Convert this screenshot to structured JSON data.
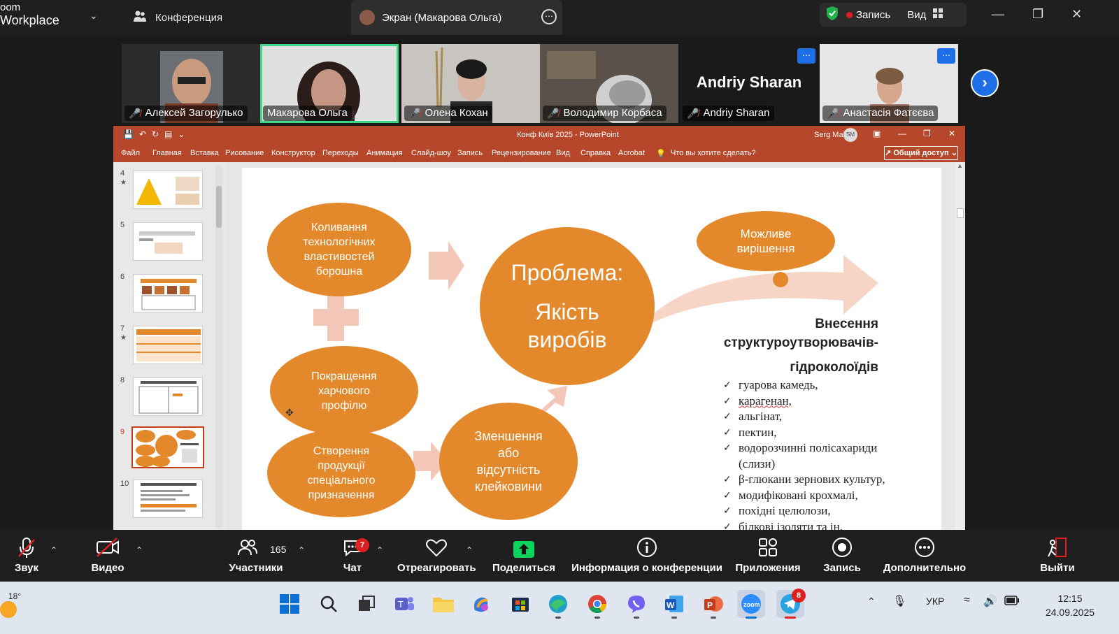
{
  "topbar": {
    "brand_line1": "oom",
    "brand_line2": "Workplace",
    "conference_label": "Конференция",
    "screen_tab_label": "Экран (Макарова Ольга)",
    "record_label": "Запись",
    "view_label": "Вид"
  },
  "gallery": {
    "participants": [
      {
        "name": "Алексей Загорулько",
        "muted": true
      },
      {
        "name": "Макарова Ольга",
        "muted": false
      },
      {
        "name": "Олена Кохан",
        "muted": true
      },
      {
        "name": "Володимир Корбаса",
        "muted": true
      },
      {
        "name": "Andriy Sharan",
        "muted": true,
        "big_name": "Andriy Sharan"
      },
      {
        "name": "Анастасія Фатєєва",
        "muted": true
      }
    ]
  },
  "ppt": {
    "window_title": "Конф Київ 2025  -  PowerPoint",
    "user_name": "Serg Mak",
    "user_initials": "SM",
    "menu": [
      "Файл",
      "Главная",
      "Вставка",
      "Рисование",
      "Конструктор",
      "Переходы",
      "Анимация",
      "Слайд-шоу",
      "Запись",
      "Рецензирование",
      "Вид",
      "Справка",
      "Acrobat"
    ],
    "tell_me": "Что вы хотите сделать?",
    "share_label": "Общий доступ",
    "thumbnails": [
      {
        "num": "4",
        "star": true
      },
      {
        "num": "5",
        "star": false
      },
      {
        "num": "6",
        "star": false
      },
      {
        "num": "7",
        "star": true
      },
      {
        "num": "8",
        "star": false
      },
      {
        "num": "9",
        "star": false,
        "selected": true
      },
      {
        "num": "10",
        "star": false
      }
    ],
    "slide": {
      "oval_fluct": "Коливання технологічних властивостей борошна",
      "oval_improve": "Покращення харчового профілю",
      "oval_special": "Створення продукції спеціального призначення",
      "oval_reduce": "Зменшення або відсутність клейковини",
      "oval_problem_1": "Проблема:",
      "oval_problem_2": "Якість виробів",
      "oval_solution": "Можливе вирішення",
      "hydro_title_1": "Внесення",
      "hydro_title_2": "структуроутворювачів-",
      "hydro_title_3": "гідроколоїдів",
      "hydro_items": [
        "гуарова камедь,",
        "карагенан,",
        "альгінат,",
        "пектин,",
        "водорозчинні полісахариди (слизи)",
        "β-глюкани зернових культур,",
        "модифіковані крохмалі,",
        "похідні целюлози,",
        "білкові ізоляти та ін."
      ]
    }
  },
  "toolbar": {
    "audio": "Звук",
    "video": "Видео",
    "participants": "Участники",
    "participants_count": "165",
    "chat": "Чат",
    "chat_badge": "7",
    "react": "Отреагировать",
    "share": "Поделиться",
    "info": "Информация о конференции",
    "apps": "Приложения",
    "record": "Запись",
    "more": "Дополнительно",
    "leave": "Выйти"
  },
  "taskbar": {
    "weather": "18°",
    "lang": "УКР",
    "time": "12:15",
    "date": "24.09.2025",
    "telegram_badge": "8"
  },
  "colors": {
    "ppt_red": "#b7472a",
    "slide_orange": "#e3892b",
    "arrow_pink": "#f3c7b7",
    "zoom_blue": "#1e6ee8",
    "active_green": "#3ed68a"
  }
}
